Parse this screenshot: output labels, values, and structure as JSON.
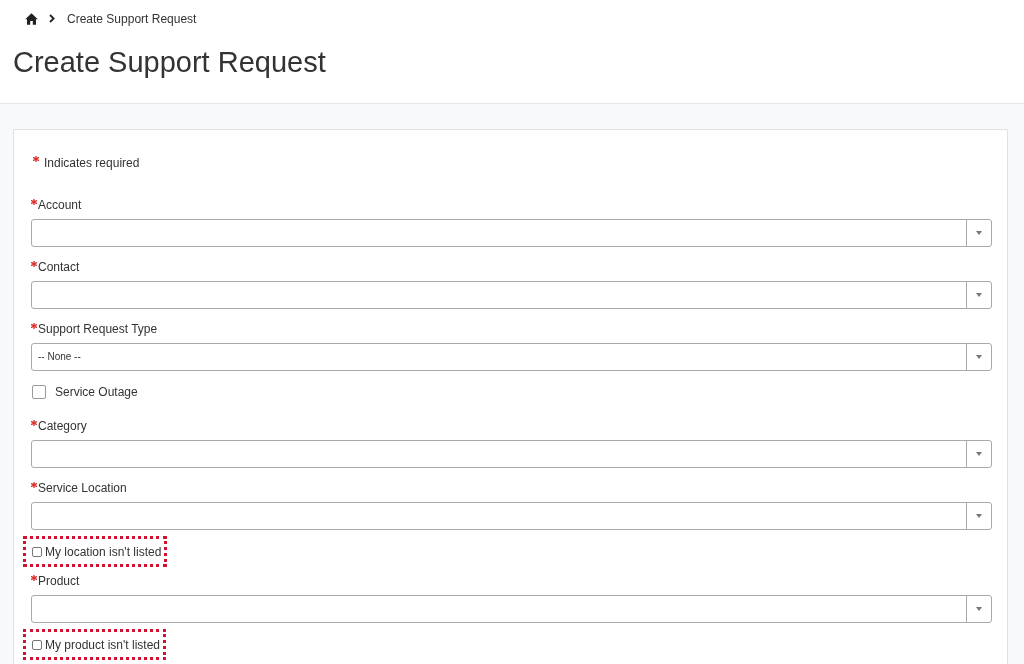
{
  "breadcrumb": {
    "current": "Create Support Request"
  },
  "page_title": "Create Support Request",
  "form": {
    "required_legend": "Indicates required",
    "fields": [
      {
        "kind": "select",
        "label": "Account",
        "required": true
      },
      {
        "kind": "select",
        "label": "Contact",
        "required": true
      },
      {
        "kind": "select",
        "label": "Support Request Type",
        "required": true,
        "value": "-- None --"
      },
      {
        "kind": "checkbox",
        "label": "Service Outage",
        "checked": false
      },
      {
        "kind": "select",
        "label": "Category",
        "required": true
      },
      {
        "kind": "select",
        "label": "Service Location",
        "required": true
      },
      {
        "kind": "small_checkbox",
        "label": "My location isn't listed",
        "checked": false,
        "highlighted": true
      },
      {
        "kind": "select",
        "label": "Product",
        "required": true
      },
      {
        "kind": "small_checkbox",
        "label": "My product isn't listed",
        "checked": false,
        "highlighted": true
      }
    ]
  }
}
